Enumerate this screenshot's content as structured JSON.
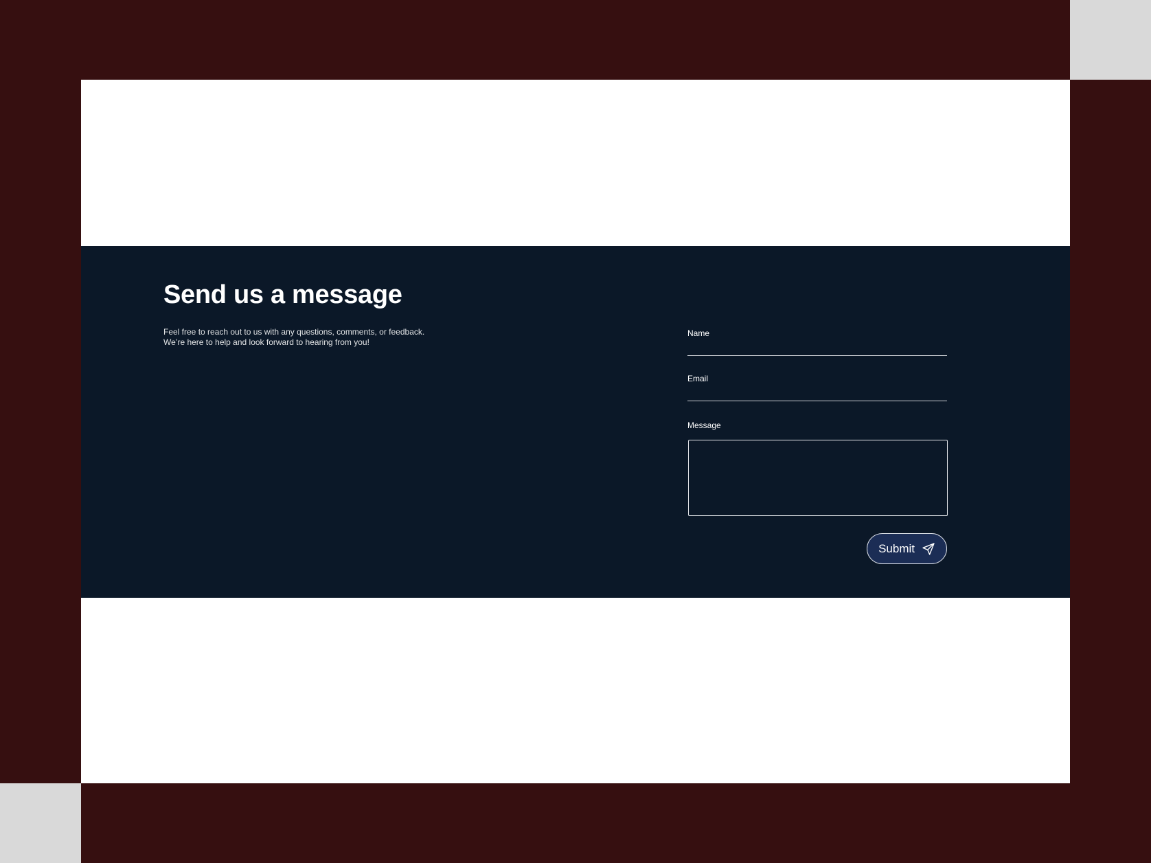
{
  "colors": {
    "backdrop": "#360f10",
    "corner_swatch": "#d9d9d9",
    "page_background": "#ffffff",
    "section_background": "#0b1828",
    "button_background": "#1b2d55",
    "text": "#ffffff"
  },
  "contact": {
    "heading": "Send us a message",
    "description_line_1": "Feel free to reach out to us with any questions, comments, or feedback.",
    "description_line_2": "We’re here to help and look forward to hearing from you!"
  },
  "form": {
    "name_label": "Name",
    "name_value": "",
    "email_label": "Email",
    "email_value": "",
    "message_label": "Message",
    "message_value": "",
    "submit_label": "Submit",
    "submit_icon": "send-icon"
  }
}
